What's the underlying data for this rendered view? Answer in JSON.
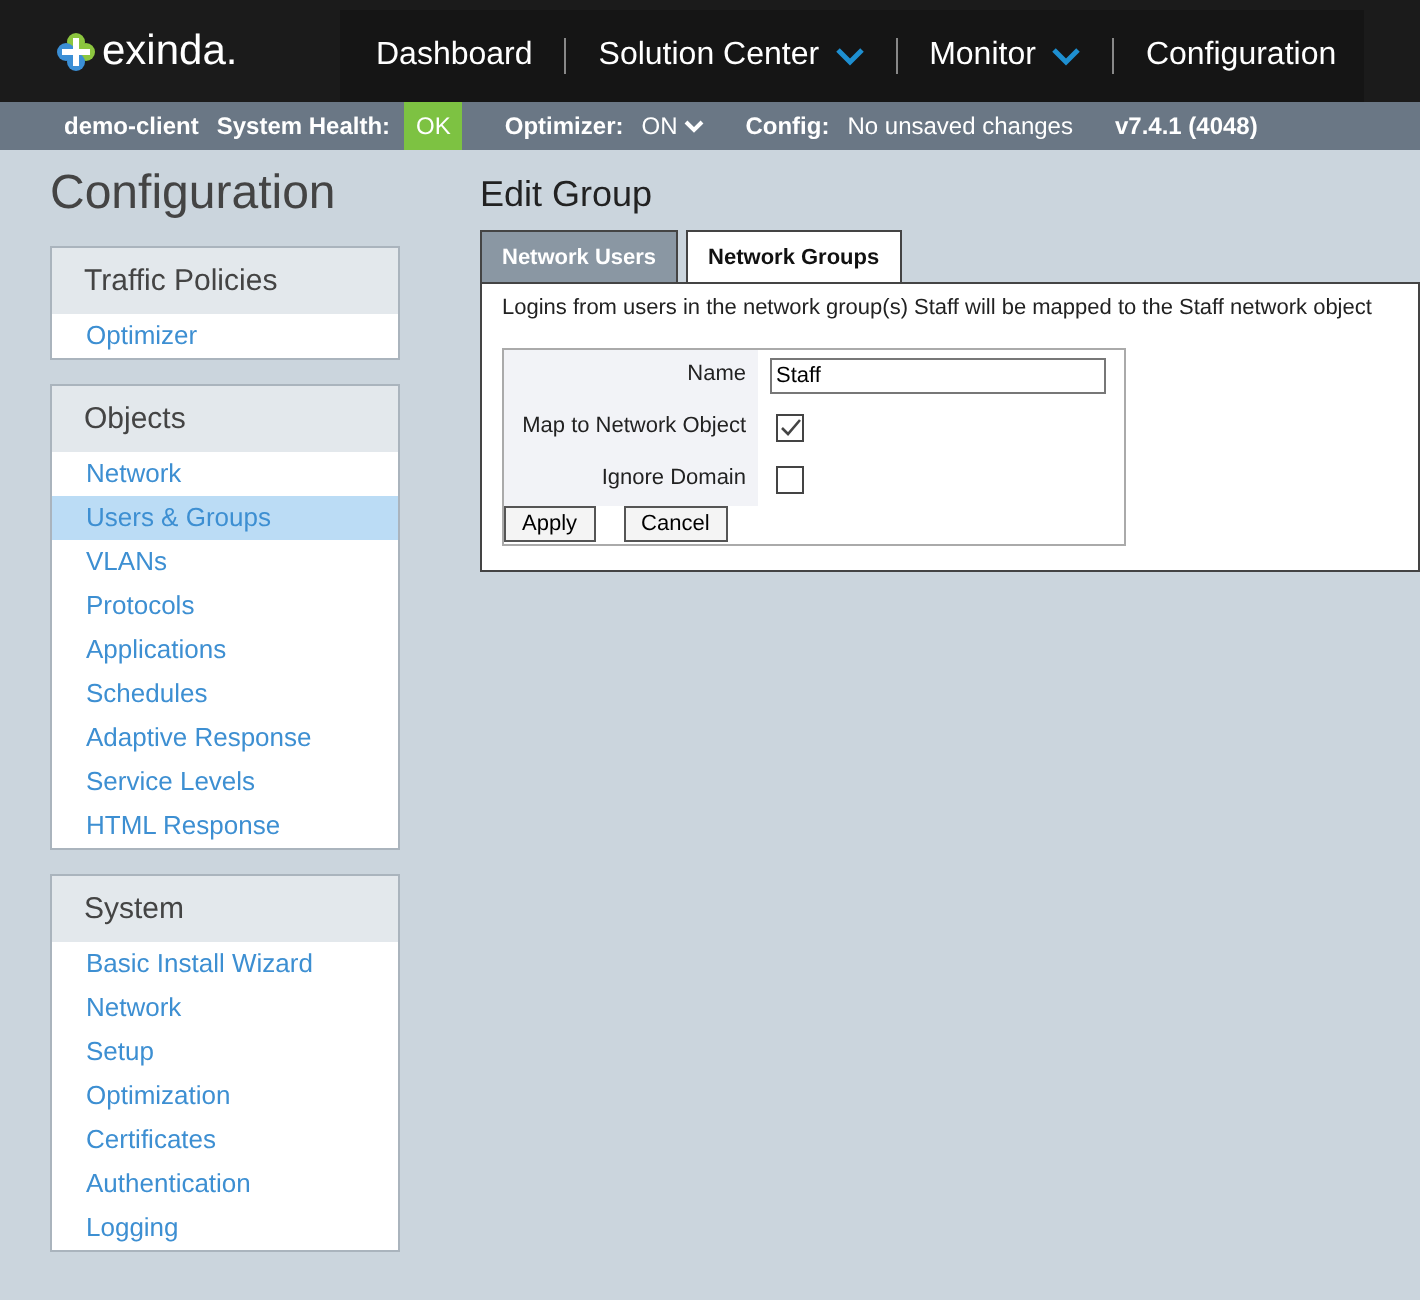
{
  "brand": {
    "name": "exinda."
  },
  "nav": [
    {
      "text": "Dashboard",
      "dropdown": false
    },
    {
      "text": "Solution Center",
      "dropdown": true
    },
    {
      "text": "Monitor",
      "dropdown": true
    },
    {
      "text": "Configuration",
      "dropdown": false
    }
  ],
  "status_bar": {
    "client": "demo-client",
    "health_label": "System Health:",
    "health_value": "OK",
    "optimizer_label": "Optimizer:",
    "optimizer_value": "ON",
    "config_label": "Config:",
    "config_value": "No unsaved changes",
    "version": "v7.4.1 (4048)"
  },
  "page_title": "Configuration",
  "sidebar": [
    {
      "title": "Traffic Policies",
      "items": [
        {
          "label": "Optimizer",
          "selected": false
        }
      ]
    },
    {
      "title": "Objects",
      "items": [
        {
          "label": "Network",
          "selected": false
        },
        {
          "label": "Users & Groups",
          "selected": true
        },
        {
          "label": "VLANs",
          "selected": false
        },
        {
          "label": "Protocols",
          "selected": false
        },
        {
          "label": "Applications",
          "selected": false
        },
        {
          "label": "Schedules",
          "selected": false
        },
        {
          "label": "Adaptive Response",
          "selected": false
        },
        {
          "label": "Service Levels",
          "selected": false
        },
        {
          "label": "HTML Response",
          "selected": false
        }
      ]
    },
    {
      "title": "System",
      "items": [
        {
          "label": "Basic Install Wizard",
          "selected": false
        },
        {
          "label": "Network",
          "selected": false
        },
        {
          "label": "Setup",
          "selected": false
        },
        {
          "label": "Optimization",
          "selected": false
        },
        {
          "label": "Certificates",
          "selected": false
        },
        {
          "label": "Authentication",
          "selected": false
        },
        {
          "label": "Logging",
          "selected": false
        }
      ]
    }
  ],
  "main": {
    "title": "Edit Group",
    "tabs": [
      {
        "label": "Network Users",
        "selected": false
      },
      {
        "label": "Network Groups",
        "selected": true
      }
    ],
    "description": "Logins from users in the network group(s) Staff will be mapped to the Staff network object",
    "form": {
      "name_label": "Name",
      "name_value": "Staff",
      "map_label": "Map to Network Object",
      "map_checked": true,
      "ignore_label": "Ignore Domain",
      "ignore_checked": false
    },
    "buttons": [
      "Apply",
      "Cancel"
    ]
  }
}
